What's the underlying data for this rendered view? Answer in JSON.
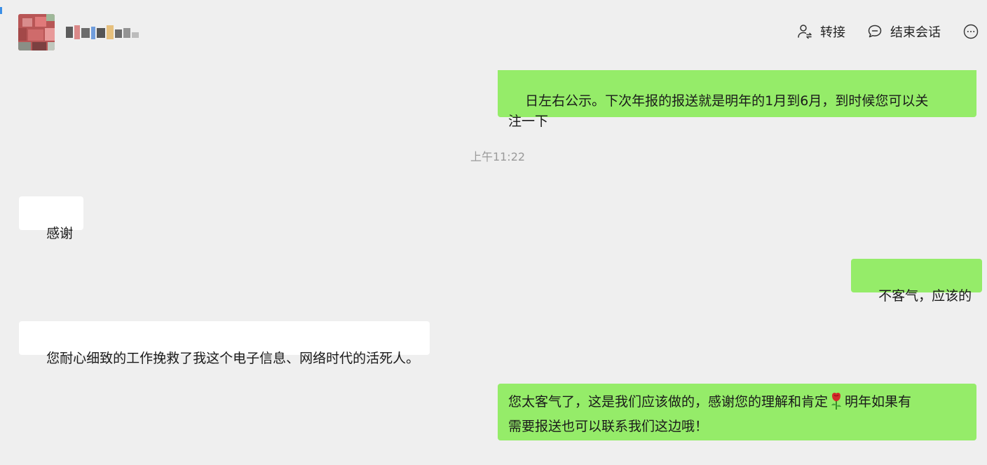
{
  "header": {
    "contact_name": "",
    "actions": [
      {
        "label": "转接",
        "icon": "transfer-user-icon"
      },
      {
        "label": "结束会话",
        "icon": "chat-bubble-icon"
      },
      {
        "label": "",
        "icon": "more-icon"
      }
    ]
  },
  "messages": {
    "m1": {
      "direction": "outgoing",
      "text": "日左右公示。下次年报的报送就是明年的1月到6月，到时候您可以关\n注一下"
    },
    "timestamp": "上午11:22",
    "m2": {
      "direction": "incoming",
      "text": "感谢"
    },
    "m3": {
      "direction": "outgoing",
      "text": "不客气，应该的"
    },
    "m4": {
      "direction": "incoming",
      "text": "您耐心细致的工作挽救了我这个电子信息、网络时代的活死人。"
    },
    "m5": {
      "direction": "outgoing",
      "text_before_emoji": "您太客气了，这是我们应该做的，感谢您的理解和肯定",
      "emoji": "rose-icon",
      "text_after_emoji": "明年如果有\n需要报送也可以联系我们这边哦！"
    }
  },
  "colors": {
    "background": "#efefef",
    "outgoing_bubble": "#95ec69",
    "incoming_bubble": "#ffffff",
    "timestamp_text": "#9a9a9a"
  }
}
